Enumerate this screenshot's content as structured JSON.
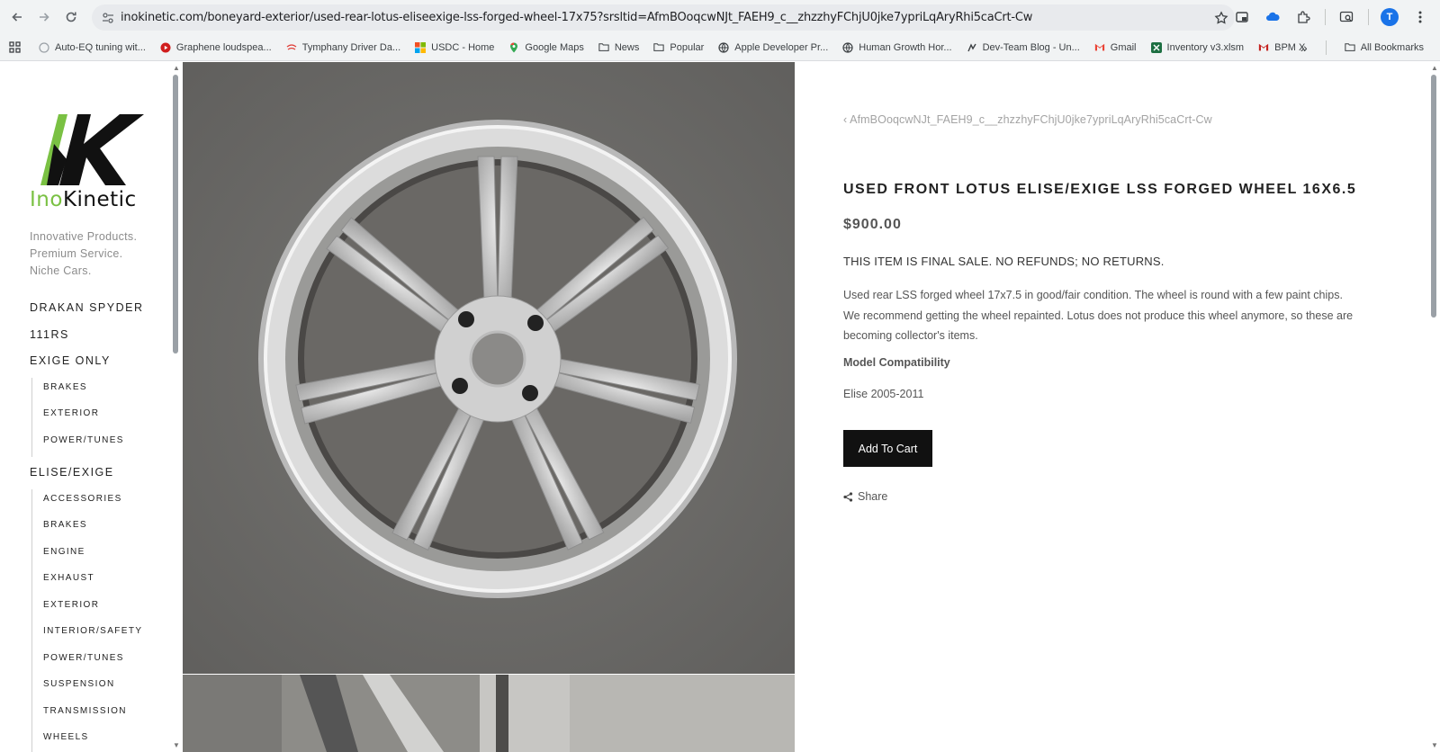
{
  "browser": {
    "url": "inokinetic.com/boneyard-exterior/used-rear-lotus-eliseexige-lss-forged-wheel-17x75?srsltid=AfmBOoqcwNJt_FAEH9_c__zhzzhyFChjU0jke7ypriLqAryRhi5caCrt-Cw",
    "profile_initial": "T",
    "bookmarks": [
      {
        "label": "Auto-EQ tuning wit...",
        "icon": "globe-icon"
      },
      {
        "label": "Graphene loudspea...",
        "icon": "youtube-icon"
      },
      {
        "label": "Tymphany Driver Da...",
        "icon": "tymphany-icon"
      },
      {
        "label": "USDC - Home",
        "icon": "windows-icon"
      },
      {
        "label": "Google Maps",
        "icon": "maps-icon"
      },
      {
        "label": "News",
        "icon": "folder-icon"
      },
      {
        "label": "Popular",
        "icon": "folder-icon"
      },
      {
        "label": "Apple Developer Pr...",
        "icon": "globe-icon"
      },
      {
        "label": "Human Growth Hor...",
        "icon": "globe-icon"
      },
      {
        "label": "Dev-Team Blog - Un...",
        "icon": "blog-icon"
      },
      {
        "label": "Gmail",
        "icon": "gmail-icon"
      },
      {
        "label": "Inventory v3.xlsm",
        "icon": "excel-icon"
      },
      {
        "label": "BPM X",
        "icon": "bpm-icon"
      }
    ],
    "all_bookmarks": "All Bookmarks"
  },
  "logo": {
    "brand": "InoKinetic"
  },
  "tagline": [
    "Innovative Products.",
    "Premium Service.",
    "Niche Cars."
  ],
  "nav": [
    {
      "label": "DRAKAN SPYDER",
      "subs": []
    },
    {
      "label": "111RS",
      "subs": []
    },
    {
      "label": "EXIGE ONLY",
      "subs": [
        "BRAKES",
        "EXTERIOR",
        "POWER/TUNES"
      ]
    },
    {
      "label": "ELISE/EXIGE",
      "subs": [
        "ACCESSORIES",
        "BRAKES",
        "ENGINE",
        "EXHAUST",
        "EXTERIOR",
        "INTERIOR/SAFETY",
        "POWER/TUNES",
        "SUSPENSION",
        "TRANSMISSION",
        "WHEELS"
      ]
    }
  ],
  "product": {
    "breadcrumb": "AfmBOoqcwNJt_FAEH9_c__zhzzhyFChjU0jke7ypriLqAryRhi5caCrt-Cw",
    "title": "USED FRONT LOTUS ELISE/EXIGE LSS FORGED WHEEL 16X6.5",
    "price": "$900.00",
    "final_sale": "THIS ITEM IS FINAL SALE. NO REFUNDS; NO RETURNS.",
    "description": "Used rear LSS forged wheel 17x7.5 in good/fair condition. The wheel is round with a few paint chips. We recommend getting the wheel repainted. Lotus does not produce this wheel anymore, so these are becoming collector's items.",
    "compat_heading": "Model Compatibility",
    "compat_value": "Elise 2005-2011",
    "add_to_cart": "Add To Cart",
    "share": "Share"
  },
  "colors": {
    "accent_green": "#7ac143",
    "button": "#111111"
  }
}
